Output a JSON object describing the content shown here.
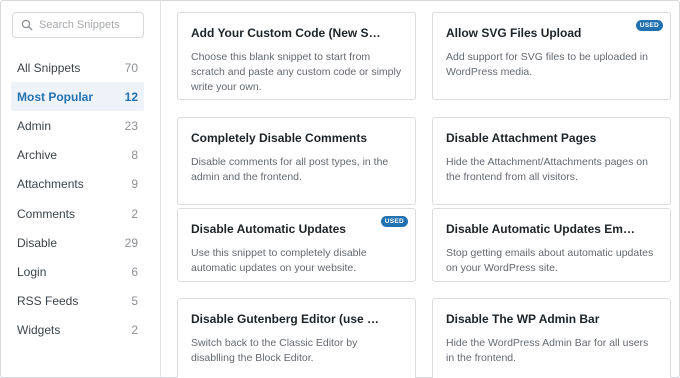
{
  "search": {
    "placeholder": "Search Snippets"
  },
  "categories": [
    {
      "label": "All Snippets",
      "count": "70"
    },
    {
      "label": "Most Popular",
      "count": "12"
    },
    {
      "label": "Admin",
      "count": "23"
    },
    {
      "label": "Archive",
      "count": "8"
    },
    {
      "label": "Attachments",
      "count": "9"
    },
    {
      "label": "Comments",
      "count": "2"
    },
    {
      "label": "Disable",
      "count": "29"
    },
    {
      "label": "Login",
      "count": "6"
    },
    {
      "label": "RSS Feeds",
      "count": "5"
    },
    {
      "label": "Widgets",
      "count": "2"
    }
  ],
  "active_category": "Most Popular",
  "snippets": [
    {
      "title": "Add Your Custom Code (New Snippet)",
      "description": "Choose this blank snippet to start from scratch and paste any custom code or simply write your own."
    },
    {
      "title": "Allow SVG Files Upload",
      "description": "Add support for SVG files to be uploaded in WordPress media.",
      "badge": "USED"
    },
    {
      "title": "Completely Disable Comments",
      "description": "Disable comments for all post types, in the admin and the frontend."
    },
    {
      "title": "Disable Attachment Pages",
      "description": "Hide the Attachment/Attachments pages on the frontend from all visitors."
    },
    {
      "title": "Disable Automatic Updates",
      "description": "Use this snippet to completely disable automatic updates on your website.",
      "badge": "USED"
    },
    {
      "title": "Disable Automatic Updates Emails",
      "description": "Stop getting emails about automatic updates on your WordPress site."
    },
    {
      "title": "Disable Gutenberg Editor (use Classic ...",
      "description": "Switch back to the Classic Editor by disablling the Block Editor."
    },
    {
      "title": "Disable The WP Admin Bar",
      "description": "Hide the WordPress Admin Bar for all users in the frontend."
    }
  ],
  "colors": {
    "accent": "#2271b1",
    "active_bg": "#eef3fa",
    "border": "#dcdde0"
  },
  "icons": {
    "search": "search-icon"
  }
}
